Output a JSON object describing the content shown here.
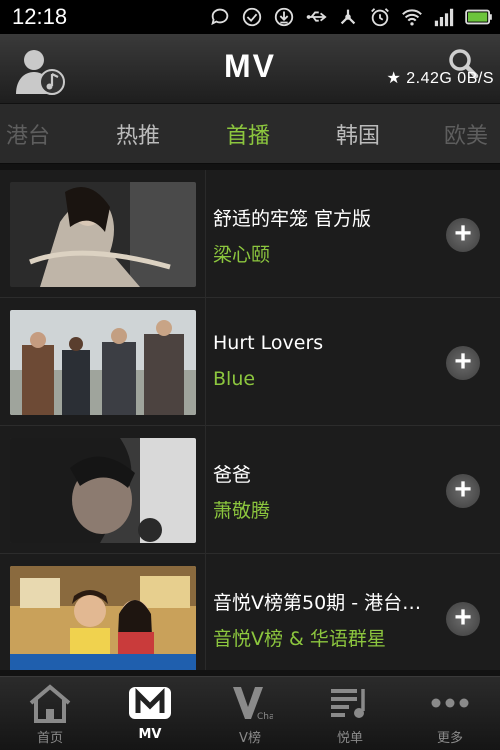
{
  "status_bar": {
    "time": "12:18",
    "icons": [
      "chat-icon",
      "check-circle-icon",
      "download-icon",
      "usb-icon",
      "share-hub-icon",
      "alarm-icon",
      "wifi-icon",
      "signal-icon",
      "battery-icon"
    ]
  },
  "header": {
    "title": "MV",
    "speed": "★ 2.42G  0B/S"
  },
  "tabs": {
    "items": [
      "港台",
      "热推",
      "首播",
      "韩国",
      "欧美"
    ],
    "active": "首播"
  },
  "videos": [
    {
      "title": "舒适的牢笼 官方版",
      "artist": "梁心颐"
    },
    {
      "title": "Hurt Lovers",
      "artist": "Blue"
    },
    {
      "title": "爸爸",
      "artist": "萧敬腾"
    },
    {
      "title": "音悦V榜第50期 - 港台…",
      "artist": "音悦V榜 & 华语群星"
    }
  ],
  "bottom_nav": {
    "items": [
      "首页",
      "MV",
      "V榜",
      "悦单",
      "更多"
    ],
    "active": "MV"
  },
  "colors": {
    "accent": "#8cc63e",
    "background": "#1c1c1c"
  }
}
